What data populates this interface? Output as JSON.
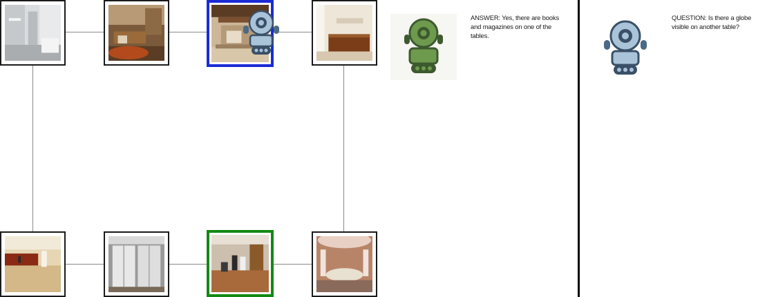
{
  "answer_panel": {
    "text": "ANSWER: Yes, there are books and magazines on one of the tables.",
    "avatar_icon": "green-robot-icon"
  },
  "question_panel": {
    "text": "QUESTION: Is there a globe visible on another table?",
    "avatar_icon": "blue-robot-icon"
  },
  "grid": {
    "top_row": [
      "white-kitchen-corridor",
      "wood-paneled-office",
      "stone-fireplace-lobby",
      "reception-desk-room"
    ],
    "bottom_row": [
      "hotel-lobby-reception",
      "archive-shelving-room",
      "reception-counter-staff",
      "domed-lobby-desk"
    ],
    "current_node_color": "#1a2bd6",
    "target_node_color": "#138a13"
  }
}
